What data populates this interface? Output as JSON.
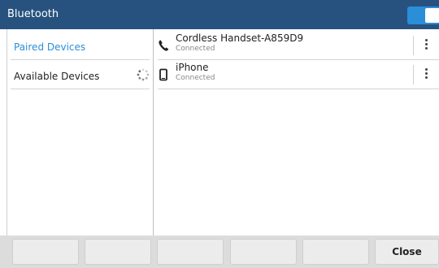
{
  "header": {
    "title": "Bluetooth",
    "toggle_on": true,
    "toggle_color": "#2a8ed9",
    "bar_color": "#27527f"
  },
  "sidebar": {
    "items": [
      {
        "label": "Paired Devices",
        "active": true
      },
      {
        "label": "Available Devices",
        "active": false,
        "icon": "loading-spinner-icon"
      }
    ]
  },
  "devices": [
    {
      "name": "Cordless Handset-A859D9",
      "status": "Connected",
      "icon": "phone-icon"
    },
    {
      "name": "iPhone",
      "status": "Connected",
      "icon": "mobile-phone-icon"
    }
  ],
  "softkeys": {
    "labels": [
      "",
      "",
      "",
      "",
      "",
      "Close"
    ]
  }
}
